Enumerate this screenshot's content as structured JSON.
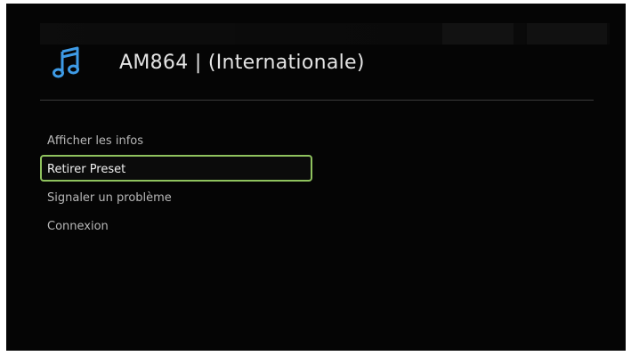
{
  "header": {
    "title": "AM864 | (Internationale)",
    "icon": "music-note-icon",
    "icon_color": "#3e9be6"
  },
  "menu": {
    "items": [
      {
        "label": "Afficher les infos",
        "selected": false
      },
      {
        "label": "Retirer Preset",
        "selected": true
      },
      {
        "label": "Signaler un problème",
        "selected": false
      },
      {
        "label": "Connexion",
        "selected": false
      }
    ],
    "selection_color": "#8fc25e"
  }
}
